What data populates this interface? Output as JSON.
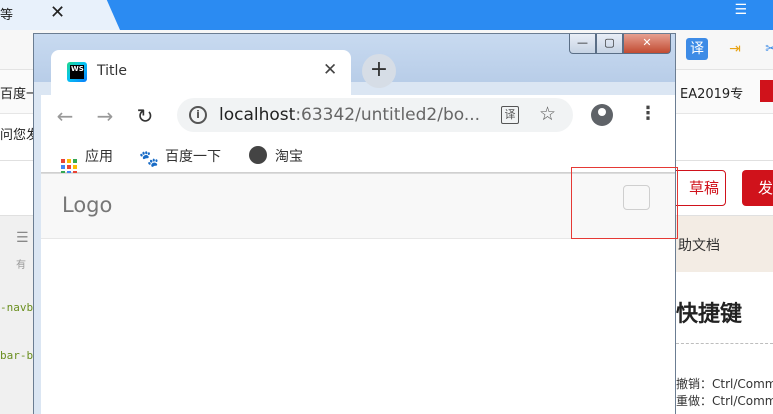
{
  "background": {
    "tab_text": "等",
    "bookmarks_left": "百度一",
    "bookmarks_right": "EA2019专",
    "question_text": "问您发",
    "draft_button": "草稿",
    "publish_button": "发",
    "sidebar_label": "有",
    "code_lines": [
      "-navb",
      "bar-b"
    ],
    "help_tab": "助文档",
    "shortcut_title": "快捷键",
    "shortcuts": [
      "撤销：Ctrl/Comm",
      "重做：Ctrl/Comm"
    ]
  },
  "window": {
    "controls": {
      "minimize": "—",
      "maximize": "▢",
      "close": "✕"
    }
  },
  "tab": {
    "favicon_text": "WS",
    "title": "Title"
  },
  "toolbar": {
    "back": "←",
    "forward": "→",
    "reload": "↻",
    "url_host": "localhost",
    "url_rest": ":63342/untitled2/bo...",
    "translate_glyph": "译",
    "star_glyph": "☆",
    "menu_glyph": "⋮"
  },
  "bookmarks": [
    {
      "label": "应用"
    },
    {
      "label": "百度一下"
    },
    {
      "label": "淘宝"
    }
  ],
  "page": {
    "logo": "Logo"
  },
  "colors": {
    "bg_blue": "#2b8bf2",
    "csdn_red": "#d0121b",
    "highlight_red": "#e53935",
    "navbar_bg": "#f8f8f8"
  }
}
